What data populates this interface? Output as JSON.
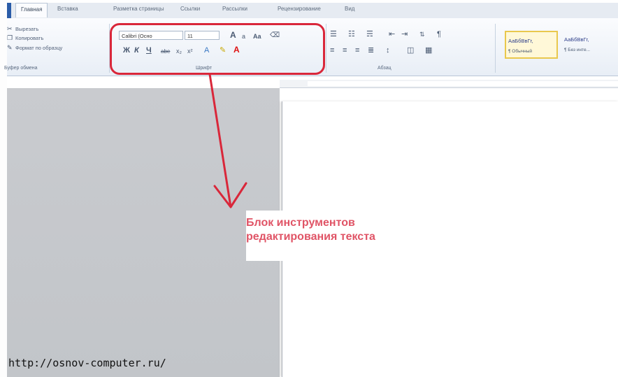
{
  "ribbon": {
    "tabs": [
      {
        "label": "Главная",
        "active": true
      },
      {
        "label": "Вставка",
        "active": false
      },
      {
        "label": "Разметка страницы",
        "active": false
      },
      {
        "label": "Ссылки",
        "active": false
      },
      {
        "label": "Рассылки",
        "active": false
      },
      {
        "label": "Рецензирование",
        "active": false
      },
      {
        "label": "Вид",
        "active": false
      }
    ],
    "clipboard": {
      "cut_label": "Вырезать",
      "copy_label": "Копировать",
      "format_painter_label": "Формат по образцу",
      "group_label": "Буфер обмена"
    },
    "font": {
      "font_name": "Calibri (Осно",
      "font_size": "11",
      "group_label": "Шрифт",
      "grow_label": "A",
      "shrink_label": "a",
      "case_label": "Aa",
      "bold_label": "Ж",
      "italic_label": "К",
      "underline_label": "Ч",
      "strike_label": "abe",
      "subscript_label": "x₂",
      "superscript_label": "x²",
      "font_color_label": "A"
    },
    "paragraph": {
      "group_label": "Абзац"
    },
    "styles": {
      "items": [
        {
          "preview": "АаБбВвГг,",
          "name": "¶ Обычный",
          "selected": true
        },
        {
          "preview": "АаБбВвГг,",
          "name": "¶ Без инте...",
          "selected": false
        }
      ]
    }
  },
  "annotation": {
    "line1": "Блок инструментов",
    "line2": "редактирования текста",
    "color": "#e05466"
  },
  "highlight_color": "#d9273a",
  "watermark": "http://osnov-computer.ru/"
}
